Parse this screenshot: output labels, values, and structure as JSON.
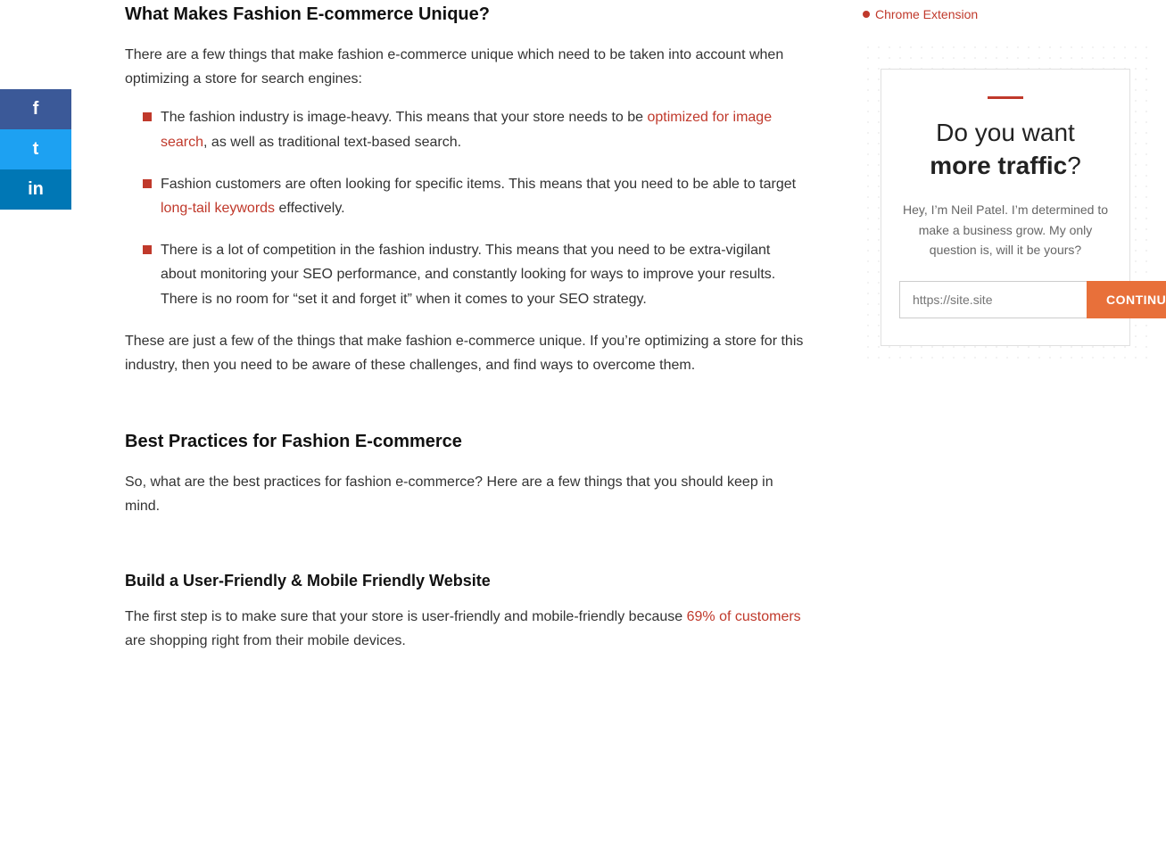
{
  "social": {
    "facebook_icon": "f",
    "twitter_icon": "t",
    "linkedin_icon": "in"
  },
  "header": {
    "chrome_extension_label": "Chrome Extension"
  },
  "article": {
    "section1": {
      "heading": "What Makes Fashion E-commerce Unique?",
      "intro": "There are a few things that make fashion e-commerce unique which need to be taken into account when optimizing a store for search engines:",
      "bullets": [
        {
          "text_before": "The fashion industry is image-heavy. This means that your store needs to be ",
          "link_text": "optimized for image search",
          "text_after": ", as well as traditional text-based search."
        },
        {
          "text_before": "Fashion customers are often looking for specific items. This means that you need to be able to target ",
          "link_text": "long-tail keywords",
          "text_after": " effectively."
        },
        {
          "text_before": "There is a lot of competition in the fashion industry. This means that you need to be extra-vigilant about monitoring your SEO performance, and constantly looking for ways to improve your results. There is no room for “set it and forget it” when it comes to your SEO strategy.",
          "link_text": "",
          "text_after": ""
        }
      ],
      "conclusion": "These are just a few of the things that make fashion e-commerce unique. If you’re optimizing a store for this industry, then you need to be aware of these challenges, and find ways to overcome them."
    },
    "section2": {
      "heading": "Best Practices for Fashion E-commerce",
      "intro": "So, what are the best practices for fashion e-commerce? Here are a few things that you should keep in mind."
    },
    "section3": {
      "heading": "Build a User-Friendly & Mobile Friendly Website",
      "intro_before": "The first step is to make sure that your store is user-friendly and mobile-friendly because ",
      "intro_link": "69% of customers",
      "intro_after": " are shopping right from their mobile devices."
    }
  },
  "widget": {
    "accent": "#c0392b",
    "title_light": "Do you want",
    "title_bold": "more traffic",
    "title_punctuation": "?",
    "description": "Hey, I’m Neil Patel. I’m determined to make a business grow. My only question is, will it be yours?",
    "input_placeholder": "https://site.site",
    "button_label": "CONTINUE"
  }
}
